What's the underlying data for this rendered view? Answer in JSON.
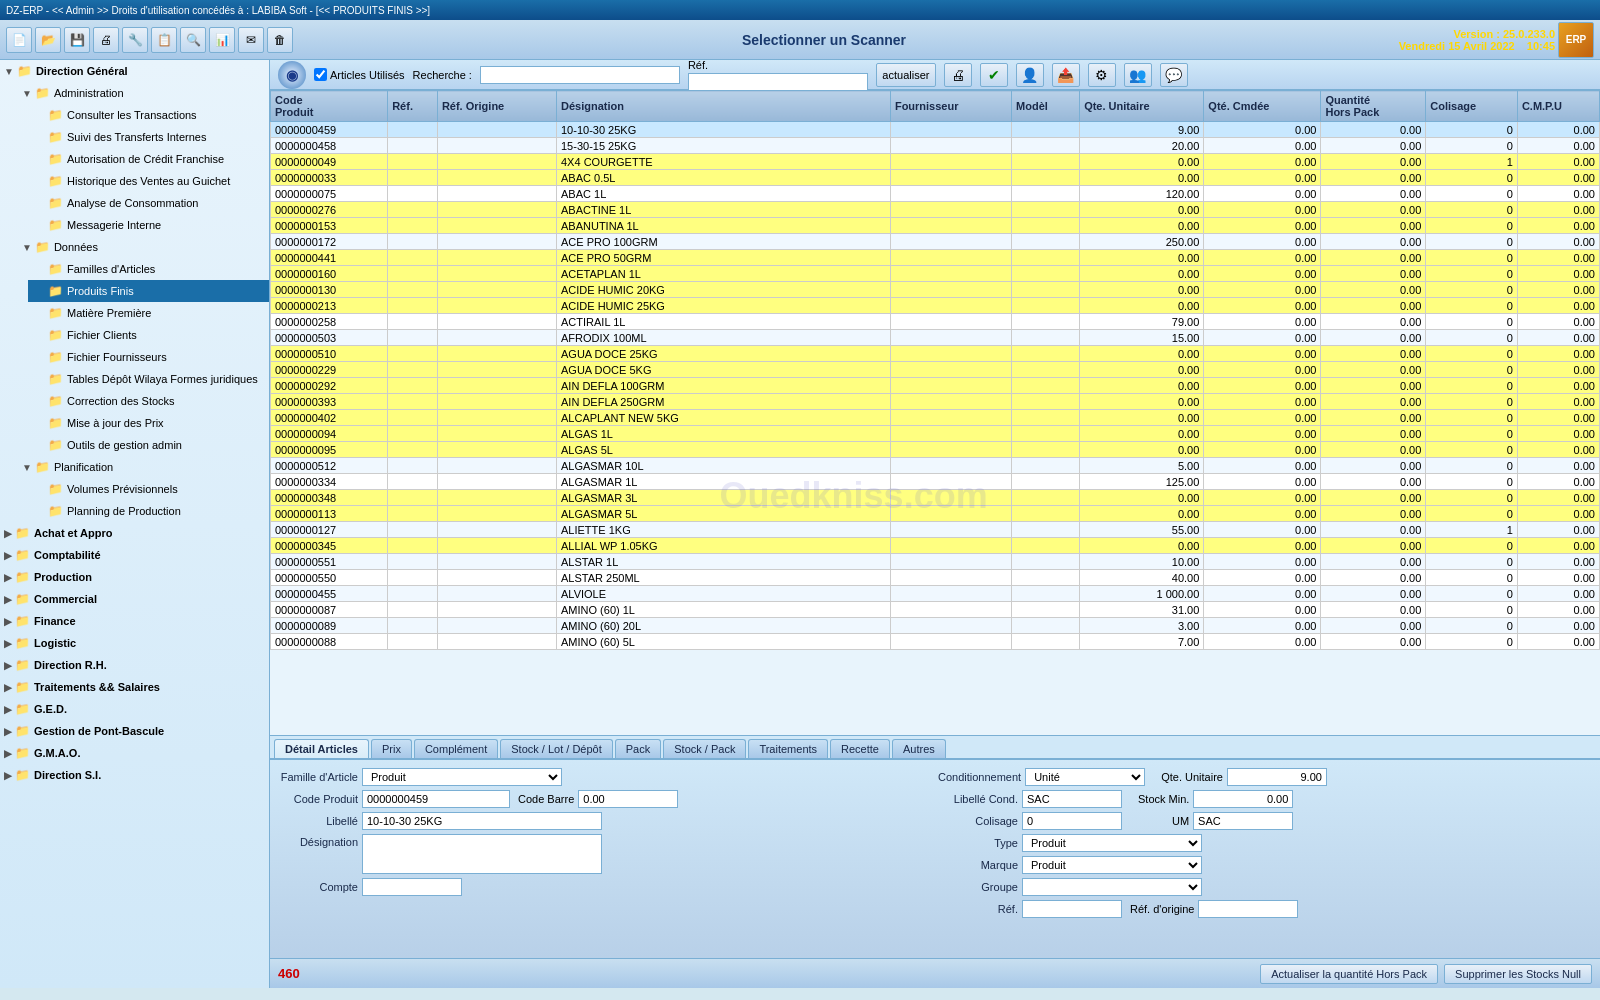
{
  "topbar": {
    "title": "DZ-ERP - << Admin >> Droits d'utilisation concédés à : LABIBA Soft - [<< PRODUITS FINIS >>]"
  },
  "header": {
    "scanner_title": "Selectionner un Scanner",
    "version": "Version : 25.0.233.0",
    "date": "Vendredi 15 Avril 2022",
    "time": "10:45"
  },
  "scanner_bar": {
    "articles_utilises": "Articles Utilisés",
    "recherche_label": "Recherche :",
    "ref_label": "Réf.",
    "actualiser": "actualiser"
  },
  "sidebar": {
    "items": [
      {
        "id": "direction-general",
        "label": "Direction Général",
        "level": 0,
        "expanded": true
      },
      {
        "id": "administration",
        "label": "Administration",
        "level": 1,
        "expanded": true
      },
      {
        "id": "consulter-transactions",
        "label": "Consulter les Transactions",
        "level": 2
      },
      {
        "id": "suivi-transferts",
        "label": "Suivi des Transferts Internes",
        "level": 2
      },
      {
        "id": "autorisation-credit",
        "label": "Autorisation de Crédit Franchise",
        "level": 2
      },
      {
        "id": "historique-ventes",
        "label": "Historique des Ventes au Guichet",
        "level": 2
      },
      {
        "id": "analyse-conso",
        "label": "Analyse de Consommation",
        "level": 2
      },
      {
        "id": "messagerie",
        "label": "Messagerie Interne",
        "level": 2
      },
      {
        "id": "donnees",
        "label": "Données",
        "level": 1,
        "expanded": true
      },
      {
        "id": "familles-articles",
        "label": "Familles d'Articles",
        "level": 2
      },
      {
        "id": "produits-finis",
        "label": "Produits Finis",
        "level": 2,
        "selected": true
      },
      {
        "id": "matiere-premiere",
        "label": "Matière Première",
        "level": 2
      },
      {
        "id": "fichier-clients",
        "label": "Fichier Clients",
        "level": 2
      },
      {
        "id": "fichier-fournisseurs",
        "label": "Fichier Fournisseurs",
        "level": 2
      },
      {
        "id": "tables-depot",
        "label": "Tables Dépôt Wilaya Formes juridiques",
        "level": 2
      },
      {
        "id": "correction-stocks",
        "label": "Correction des Stocks",
        "level": 2
      },
      {
        "id": "mise-jour-prix",
        "label": "Mise à jour des Prix",
        "level": 2
      },
      {
        "id": "outils-gestion",
        "label": "Outils de gestion admin",
        "level": 2
      },
      {
        "id": "planification",
        "label": "Planification",
        "level": 1,
        "expanded": true
      },
      {
        "id": "volumes-prev",
        "label": "Volumes Prévisionnels",
        "level": 2
      },
      {
        "id": "planning-production",
        "label": "Planning de Production",
        "level": 2
      },
      {
        "id": "achat-appro",
        "label": "Achat et Appro",
        "level": 0
      },
      {
        "id": "comptabilite",
        "label": "Comptabilité",
        "level": 0
      },
      {
        "id": "production",
        "label": "Production",
        "level": 0
      },
      {
        "id": "commercial",
        "label": "Commercial",
        "level": 0
      },
      {
        "id": "finance",
        "label": "Finance",
        "level": 0
      },
      {
        "id": "logistic",
        "label": "Logistic",
        "level": 0
      },
      {
        "id": "direction-rh",
        "label": "Direction R.H.",
        "level": 0
      },
      {
        "id": "traitements",
        "label": "Traitements && Salaires",
        "level": 0
      },
      {
        "id": "ged",
        "label": "G.E.D.",
        "level": 0
      },
      {
        "id": "gestion-pont",
        "label": "Gestion de Pont-Bascule",
        "level": 0
      },
      {
        "id": "gmao",
        "label": "G.M.A.O.",
        "level": 0
      },
      {
        "id": "direction-si",
        "label": "Direction S.I.",
        "level": 0
      }
    ]
  },
  "table": {
    "columns": [
      "Code Produit",
      "Réf.",
      "Réf. Origine",
      "Désignation",
      "Fournisseur",
      "Modèl",
      "Qte. Unitaire",
      "Qté. Cmdée",
      "Quantité Hors Pack",
      "Colisage",
      "C.M.P.U"
    ],
    "rows": [
      {
        "code": "0000000459",
        "ref": "",
        "ref_orig": "",
        "desig": "10-10-30 25KG",
        "fourn": "",
        "model": "",
        "qte_unit": "9.00",
        "qte_cmd": "0.00",
        "qte_hors": "0.00",
        "col": "0",
        "cmpu": "0.00",
        "yellow": false
      },
      {
        "code": "0000000458",
        "ref": "",
        "ref_orig": "",
        "desig": "15-30-15 25KG",
        "fourn": "",
        "model": "",
        "qte_unit": "20.00",
        "qte_cmd": "0.00",
        "qte_hors": "0.00",
        "col": "0",
        "cmpu": "0.00",
        "yellow": false
      },
      {
        "code": "0000000049",
        "ref": "",
        "ref_orig": "",
        "desig": "4X4 COURGETTE",
        "fourn": "",
        "model": "",
        "qte_unit": "0.00",
        "qte_cmd": "0.00",
        "qte_hors": "0.00",
        "col": "1",
        "cmpu": "0.00",
        "yellow": true
      },
      {
        "code": "0000000033",
        "ref": "",
        "ref_orig": "",
        "desig": "ABAC 0.5L",
        "fourn": "",
        "model": "",
        "qte_unit": "0.00",
        "qte_cmd": "0.00",
        "qte_hors": "0.00",
        "col": "0",
        "cmpu": "0.00",
        "yellow": true
      },
      {
        "code": "0000000075",
        "ref": "",
        "ref_orig": "",
        "desig": "ABAC 1L",
        "fourn": "",
        "model": "",
        "qte_unit": "120.00",
        "qte_cmd": "0.00",
        "qte_hors": "0.00",
        "col": "0",
        "cmpu": "0.00",
        "yellow": false
      },
      {
        "code": "0000000276",
        "ref": "",
        "ref_orig": "",
        "desig": "ABACTINE 1L",
        "fourn": "",
        "model": "",
        "qte_unit": "0.00",
        "qte_cmd": "0.00",
        "qte_hors": "0.00",
        "col": "0",
        "cmpu": "0.00",
        "yellow": true
      },
      {
        "code": "0000000153",
        "ref": "",
        "ref_orig": "",
        "desig": "ABANUTINA 1L",
        "fourn": "",
        "model": "",
        "qte_unit": "0.00",
        "qte_cmd": "0.00",
        "qte_hors": "0.00",
        "col": "0",
        "cmpu": "0.00",
        "yellow": true
      },
      {
        "code": "0000000172",
        "ref": "",
        "ref_orig": "",
        "desig": "ACE PRO 100GRM",
        "fourn": "",
        "model": "",
        "qte_unit": "250.00",
        "qte_cmd": "0.00",
        "qte_hors": "0.00",
        "col": "0",
        "cmpu": "0.00",
        "yellow": false
      },
      {
        "code": "0000000441",
        "ref": "",
        "ref_orig": "",
        "desig": "ACE PRO 50GRM",
        "fourn": "",
        "model": "",
        "qte_unit": "0.00",
        "qte_cmd": "0.00",
        "qte_hors": "0.00",
        "col": "0",
        "cmpu": "0.00",
        "yellow": true
      },
      {
        "code": "0000000160",
        "ref": "",
        "ref_orig": "",
        "desig": "ACETAPLAN 1L",
        "fourn": "",
        "model": "",
        "qte_unit": "0.00",
        "qte_cmd": "0.00",
        "qte_hors": "0.00",
        "col": "0",
        "cmpu": "0.00",
        "yellow": true
      },
      {
        "code": "0000000130",
        "ref": "",
        "ref_orig": "",
        "desig": "ACIDE HUMIC 20KG",
        "fourn": "",
        "model": "",
        "qte_unit": "0.00",
        "qte_cmd": "0.00",
        "qte_hors": "0.00",
        "col": "0",
        "cmpu": "0.00",
        "yellow": true
      },
      {
        "code": "0000000213",
        "ref": "",
        "ref_orig": "",
        "desig": "ACIDE HUMIC 25KG",
        "fourn": "",
        "model": "",
        "qte_unit": "0.00",
        "qte_cmd": "0.00",
        "qte_hors": "0.00",
        "col": "0",
        "cmpu": "0.00",
        "yellow": true
      },
      {
        "code": "0000000258",
        "ref": "",
        "ref_orig": "",
        "desig": "ACTIRAIL 1L",
        "fourn": "",
        "model": "",
        "qte_unit": "79.00",
        "qte_cmd": "0.00",
        "qte_hors": "0.00",
        "col": "0",
        "cmpu": "0.00",
        "yellow": false
      },
      {
        "code": "0000000503",
        "ref": "",
        "ref_orig": "",
        "desig": "AFRODIX 100ML",
        "fourn": "",
        "model": "",
        "qte_unit": "15.00",
        "qte_cmd": "0.00",
        "qte_hors": "0.00",
        "col": "0",
        "cmpu": "0.00",
        "yellow": false
      },
      {
        "code": "0000000510",
        "ref": "",
        "ref_orig": "",
        "desig": "AGUA DOCE 25KG",
        "fourn": "",
        "model": "",
        "qte_unit": "0.00",
        "qte_cmd": "0.00",
        "qte_hors": "0.00",
        "col": "0",
        "cmpu": "0.00",
        "yellow": true
      },
      {
        "code": "0000000229",
        "ref": "",
        "ref_orig": "",
        "desig": "AGUA DOCE 5KG",
        "fourn": "",
        "model": "",
        "qte_unit": "0.00",
        "qte_cmd": "0.00",
        "qte_hors": "0.00",
        "col": "0",
        "cmpu": "0.00",
        "yellow": true
      },
      {
        "code": "0000000292",
        "ref": "",
        "ref_orig": "",
        "desig": "AIN DEFLA 100GRM",
        "fourn": "",
        "model": "",
        "qte_unit": "0.00",
        "qte_cmd": "0.00",
        "qte_hors": "0.00",
        "col": "0",
        "cmpu": "0.00",
        "yellow": true
      },
      {
        "code": "0000000393",
        "ref": "",
        "ref_orig": "",
        "desig": "AIN DEFLA 250GRM",
        "fourn": "",
        "model": "",
        "qte_unit": "0.00",
        "qte_cmd": "0.00",
        "qte_hors": "0.00",
        "col": "0",
        "cmpu": "0.00",
        "yellow": true
      },
      {
        "code": "0000000402",
        "ref": "",
        "ref_orig": "",
        "desig": "ALCAPLANT NEW 5KG",
        "fourn": "",
        "model": "",
        "qte_unit": "0.00",
        "qte_cmd": "0.00",
        "qte_hors": "0.00",
        "col": "0",
        "cmpu": "0.00",
        "yellow": true
      },
      {
        "code": "0000000094",
        "ref": "",
        "ref_orig": "",
        "desig": "ALGAS 1L",
        "fourn": "",
        "model": "",
        "qte_unit": "0.00",
        "qte_cmd": "0.00",
        "qte_hors": "0.00",
        "col": "0",
        "cmpu": "0.00",
        "yellow": true
      },
      {
        "code": "0000000095",
        "ref": "",
        "ref_orig": "",
        "desig": "ALGAS 5L",
        "fourn": "",
        "model": "",
        "qte_unit": "0.00",
        "qte_cmd": "0.00",
        "qte_hors": "0.00",
        "col": "0",
        "cmpu": "0.00",
        "yellow": true
      },
      {
        "code": "0000000512",
        "ref": "",
        "ref_orig": "",
        "desig": "ALGASMAR 10L",
        "fourn": "",
        "model": "",
        "qte_unit": "5.00",
        "qte_cmd": "0.00",
        "qte_hors": "0.00",
        "col": "0",
        "cmpu": "0.00",
        "yellow": false
      },
      {
        "code": "0000000334",
        "ref": "",
        "ref_orig": "",
        "desig": "ALGASMAR 1L",
        "fourn": "",
        "model": "",
        "qte_unit": "125.00",
        "qte_cmd": "0.00",
        "qte_hors": "0.00",
        "col": "0",
        "cmpu": "0.00",
        "yellow": false
      },
      {
        "code": "0000000348",
        "ref": "",
        "ref_orig": "",
        "desig": "ALGASMAR 3L",
        "fourn": "",
        "model": "",
        "qte_unit": "0.00",
        "qte_cmd": "0.00",
        "qte_hors": "0.00",
        "col": "0",
        "cmpu": "0.00",
        "yellow": true
      },
      {
        "code": "0000000113",
        "ref": "",
        "ref_orig": "",
        "desig": "ALGASMAR 5L",
        "fourn": "",
        "model": "",
        "qte_unit": "0.00",
        "qte_cmd": "0.00",
        "qte_hors": "0.00",
        "col": "0",
        "cmpu": "0.00",
        "yellow": true
      },
      {
        "code": "0000000127",
        "ref": "",
        "ref_orig": "",
        "desig": "ALIETTE 1KG",
        "fourn": "",
        "model": "",
        "qte_unit": "55.00",
        "qte_cmd": "0.00",
        "qte_hors": "0.00",
        "col": "1",
        "cmpu": "0.00",
        "yellow": false
      },
      {
        "code": "0000000345",
        "ref": "",
        "ref_orig": "",
        "desig": "ALLIAL WP 1.05KG",
        "fourn": "",
        "model": "",
        "qte_unit": "0.00",
        "qte_cmd": "0.00",
        "qte_hors": "0.00",
        "col": "0",
        "cmpu": "0.00",
        "yellow": true
      },
      {
        "code": "0000000551",
        "ref": "",
        "ref_orig": "",
        "desig": "ALSTAR 1L",
        "fourn": "",
        "model": "",
        "qte_unit": "10.00",
        "qte_cmd": "0.00",
        "qte_hors": "0.00",
        "col": "0",
        "cmpu": "0.00",
        "yellow": false
      },
      {
        "code": "0000000550",
        "ref": "",
        "ref_orig": "",
        "desig": "ALSTAR 250ML",
        "fourn": "",
        "model": "",
        "qte_unit": "40.00",
        "qte_cmd": "0.00",
        "qte_hors": "0.00",
        "col": "0",
        "cmpu": "0.00",
        "yellow": false
      },
      {
        "code": "0000000455",
        "ref": "",
        "ref_orig": "",
        "desig": "ALVIOLE",
        "fourn": "",
        "model": "",
        "qte_unit": "1 000.00",
        "qte_cmd": "0.00",
        "qte_hors": "0.00",
        "col": "0",
        "cmpu": "0.00",
        "yellow": false
      },
      {
        "code": "0000000087",
        "ref": "",
        "ref_orig": "",
        "desig": "AMINO (60) 1L",
        "fourn": "",
        "model": "",
        "qte_unit": "31.00",
        "qte_cmd": "0.00",
        "qte_hors": "0.00",
        "col": "0",
        "cmpu": "0.00",
        "yellow": false
      },
      {
        "code": "0000000089",
        "ref": "",
        "ref_orig": "",
        "desig": "AMINO (60) 20L",
        "fourn": "",
        "model": "",
        "qte_unit": "3.00",
        "qte_cmd": "0.00",
        "qte_hors": "0.00",
        "col": "0",
        "cmpu": "0.00",
        "yellow": false
      },
      {
        "code": "0000000088",
        "ref": "",
        "ref_orig": "",
        "desig": "AMINO (60) 5L",
        "fourn": "",
        "model": "",
        "qte_unit": "7.00",
        "qte_cmd": "0.00",
        "qte_hors": "0.00",
        "col": "0",
        "cmpu": "0.00",
        "yellow": false
      }
    ]
  },
  "tabs": {
    "items": [
      "Détail Articles",
      "Prix",
      "Complément",
      "Stock / Lot / Dépôt",
      "Pack",
      "Stock / Pack",
      "Traitements",
      "Recette",
      "Autres"
    ],
    "active": 0
  },
  "detail": {
    "famille_label": "Famille d'Article",
    "famille_value": "Produit",
    "code_produit_label": "Code Produit",
    "code_produit_value": "0000000459",
    "code_barre_label": "Code Barre",
    "code_barre_value": "0.00",
    "libelle_label": "Libellé",
    "libelle_value": "10-10-30 25KG",
    "designation_label": "Désignation",
    "designation_value": "",
    "compte_label": "Compte",
    "compte_value": "",
    "conditionnement_label": "Conditionnement",
    "conditionnement_value": "Unité",
    "libelle_cond_label": "Libellé Cond.",
    "libelle_cond_value": "SAC",
    "colisage_label": "Colisage",
    "colisage_value": "0",
    "type_label": "Type",
    "type_value": "Produit",
    "marque_label": "Marque",
    "marque_value": "Produit",
    "groupe_label": "Groupe",
    "groupe_value": "",
    "ref_label": "Réf.",
    "ref_value": "",
    "ref_origine_label": "Réf. d'origine",
    "ref_origine_value": "",
    "qte_unitaire_label": "Qte. Unitaire",
    "qte_unitaire_value": "9.00",
    "stock_min_label": "Stock Min.",
    "stock_min_value": "0.00",
    "um_label": "UM",
    "um_value": "SAC"
  },
  "statusbar": {
    "count": "460",
    "btn_actualiser": "Actualiser la quantité Hors Pack",
    "btn_supprimer": "Supprimer les Stocks Null"
  }
}
